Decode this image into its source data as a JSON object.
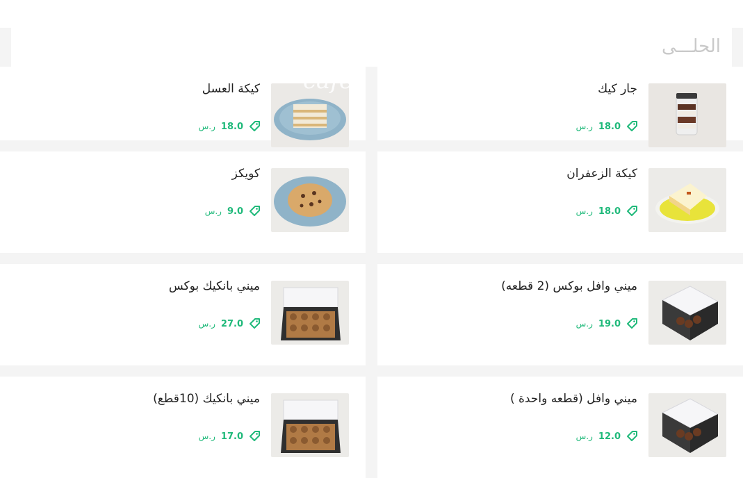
{
  "section": {
    "title": "الحلـــى"
  },
  "watermark": "cafe",
  "currency": "ر.س",
  "items": [
    {
      "name": "جار كيك",
      "price": "18.0",
      "image": "jar-cake"
    },
    {
      "name": "كيكة العسل",
      "price": "18.0",
      "image": "honey-cake"
    },
    {
      "name": "كيكة الزعفران",
      "price": "18.0",
      "image": "saffron-cake"
    },
    {
      "name": "كويكز",
      "price": "9.0",
      "image": "cookie"
    },
    {
      "name": "ميني وافل بوكس (2 قطعه)",
      "price": "19.0",
      "image": "mini-waffle-box"
    },
    {
      "name": "ميني بانكيك بوكس",
      "price": "27.0",
      "image": "mini-pancake-box"
    },
    {
      "name": "ميني وافل (قطعه واحدة )",
      "price": "12.0",
      "image": "mini-waffle-box"
    },
    {
      "name": "ميني بانكيك (10قطع)",
      "price": "17.0",
      "image": "mini-pancake-box"
    }
  ]
}
